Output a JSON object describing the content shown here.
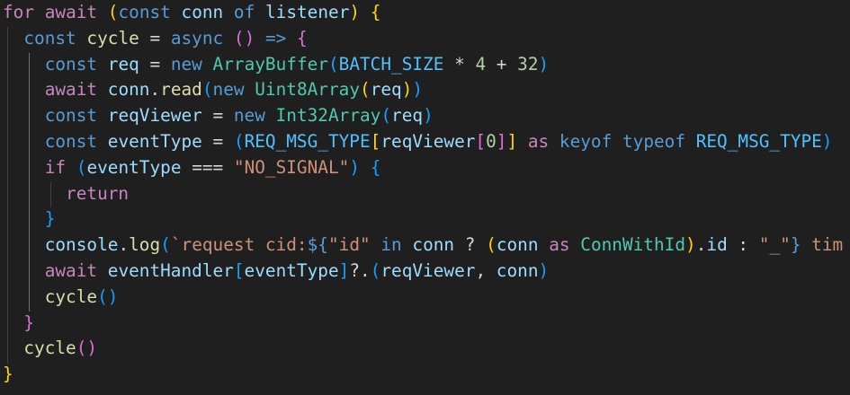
{
  "editor": {
    "language": "typescript",
    "theme_background": "#1f1f1f",
    "lines": [
      [
        [
          "kw-ctl",
          "for"
        ],
        [
          "op",
          " "
        ],
        [
          "kw-ctl",
          "await"
        ],
        [
          "op",
          " "
        ],
        [
          "b1",
          "("
        ],
        [
          "kw",
          "const"
        ],
        [
          "op",
          " "
        ],
        [
          "var",
          "conn"
        ],
        [
          "op",
          " "
        ],
        [
          "kw",
          "of"
        ],
        [
          "op",
          " "
        ],
        [
          "var",
          "listener"
        ],
        [
          "b1",
          ")"
        ],
        [
          "op",
          " "
        ],
        [
          "b1",
          "{"
        ]
      ],
      [
        [
          "op",
          "  "
        ],
        [
          "kw",
          "const"
        ],
        [
          "op",
          " "
        ],
        [
          "fn",
          "cycle"
        ],
        [
          "op",
          " = "
        ],
        [
          "kw",
          "async"
        ],
        [
          "op",
          " "
        ],
        [
          "b2",
          "()"
        ],
        [
          "op",
          " "
        ],
        [
          "kw",
          "=>"
        ],
        [
          "op",
          " "
        ],
        [
          "b2",
          "{"
        ]
      ],
      [
        [
          "op",
          "    "
        ],
        [
          "kw",
          "const"
        ],
        [
          "op",
          " "
        ],
        [
          "var",
          "req"
        ],
        [
          "op",
          " = "
        ],
        [
          "kw",
          "new"
        ],
        [
          "op",
          " "
        ],
        [
          "type",
          "ArrayBuffer"
        ],
        [
          "b3",
          "("
        ],
        [
          "const",
          "BATCH_SIZE"
        ],
        [
          "op",
          " * "
        ],
        [
          "num",
          "4"
        ],
        [
          "op",
          " + "
        ],
        [
          "num",
          "32"
        ],
        [
          "b3",
          ")"
        ]
      ],
      [
        [
          "op",
          "    "
        ],
        [
          "kw-ctl",
          "await"
        ],
        [
          "op",
          " "
        ],
        [
          "var",
          "conn"
        ],
        [
          "op",
          "."
        ],
        [
          "fn",
          "read"
        ],
        [
          "b3",
          "("
        ],
        [
          "kw",
          "new"
        ],
        [
          "op",
          " "
        ],
        [
          "type",
          "Uint8Array"
        ],
        [
          "b1",
          "("
        ],
        [
          "var",
          "req"
        ],
        [
          "b1",
          ")"
        ],
        [
          "b3",
          ")"
        ]
      ],
      [
        [
          "op",
          "    "
        ],
        [
          "kw",
          "const"
        ],
        [
          "op",
          " "
        ],
        [
          "var",
          "reqViewer"
        ],
        [
          "op",
          " = "
        ],
        [
          "kw",
          "new"
        ],
        [
          "op",
          " "
        ],
        [
          "type",
          "Int32Array"
        ],
        [
          "b3",
          "("
        ],
        [
          "var",
          "req"
        ],
        [
          "b3",
          ")"
        ]
      ],
      [
        [
          "op",
          "    "
        ],
        [
          "kw",
          "const"
        ],
        [
          "op",
          " "
        ],
        [
          "var",
          "eventType"
        ],
        [
          "op",
          " = "
        ],
        [
          "b3",
          "("
        ],
        [
          "const",
          "REQ_MSG_TYPE"
        ],
        [
          "b1",
          "["
        ],
        [
          "var",
          "reqViewer"
        ],
        [
          "b2",
          "["
        ],
        [
          "num",
          "0"
        ],
        [
          "b2",
          "]"
        ],
        [
          "b1",
          "]"
        ],
        [
          "op",
          " "
        ],
        [
          "kw-ctl",
          "as"
        ],
        [
          "op",
          " "
        ],
        [
          "kw",
          "keyof"
        ],
        [
          "op",
          " "
        ],
        [
          "kw",
          "typeof"
        ],
        [
          "op",
          " "
        ],
        [
          "const",
          "REQ_MSG_TYPE"
        ],
        [
          "b3",
          ")"
        ]
      ],
      [
        [
          "op",
          "    "
        ],
        [
          "kw-ctl",
          "if"
        ],
        [
          "op",
          " "
        ],
        [
          "b3",
          "("
        ],
        [
          "var",
          "eventType"
        ],
        [
          "op",
          " === "
        ],
        [
          "str",
          "\"NO_SIGNAL\""
        ],
        [
          "b3",
          ")"
        ],
        [
          "op",
          " "
        ],
        [
          "b3",
          "{"
        ]
      ],
      [
        [
          "op",
          "      "
        ],
        [
          "kw-ctl",
          "return"
        ]
      ],
      [
        [
          "op",
          "    "
        ],
        [
          "b3",
          "}"
        ]
      ],
      [
        [
          "op",
          "    "
        ],
        [
          "var",
          "console"
        ],
        [
          "op",
          "."
        ],
        [
          "fn",
          "log"
        ],
        [
          "b3",
          "("
        ],
        [
          "str",
          "`request cid:"
        ],
        [
          "tpl",
          "${"
        ],
        [
          "str",
          "\"id\""
        ],
        [
          "op",
          " "
        ],
        [
          "kw",
          "in"
        ],
        [
          "op",
          " "
        ],
        [
          "var",
          "conn"
        ],
        [
          "op",
          " ? "
        ],
        [
          "b1",
          "("
        ],
        [
          "var",
          "conn"
        ],
        [
          "op",
          " "
        ],
        [
          "kw-ctl",
          "as"
        ],
        [
          "op",
          " "
        ],
        [
          "type",
          "ConnWithId"
        ],
        [
          "b1",
          ")"
        ],
        [
          "op",
          "."
        ],
        [
          "var",
          "id"
        ],
        [
          "op",
          " : "
        ],
        [
          "str",
          "\"_\""
        ],
        [
          "tpl",
          "}"
        ],
        [
          "str",
          " tim"
        ]
      ],
      [
        [
          "op",
          "    "
        ],
        [
          "kw-ctl",
          "await"
        ],
        [
          "op",
          " "
        ],
        [
          "var",
          "eventHandler"
        ],
        [
          "b3",
          "["
        ],
        [
          "var",
          "eventType"
        ],
        [
          "b3",
          "]"
        ],
        [
          "op",
          "?."
        ],
        [
          "b3",
          "("
        ],
        [
          "var",
          "reqViewer"
        ],
        [
          "op",
          ", "
        ],
        [
          "var",
          "conn"
        ],
        [
          "b3",
          ")"
        ]
      ],
      [
        [
          "op",
          "    "
        ],
        [
          "fn",
          "cycle"
        ],
        [
          "b3",
          "()"
        ]
      ],
      [
        [
          "op",
          "  "
        ],
        [
          "b2",
          "}"
        ]
      ],
      [
        [
          "op",
          "  "
        ],
        [
          "fn",
          "cycle"
        ],
        [
          "b2",
          "()"
        ]
      ],
      [
        [
          "b1",
          "}"
        ]
      ]
    ]
  }
}
